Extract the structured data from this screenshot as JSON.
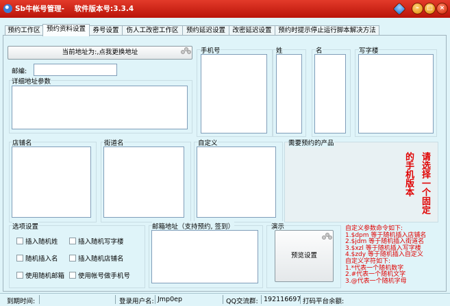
{
  "window": {
    "title": "Sb牛帐号管理-    软件版本号:3.3.4"
  },
  "tabs": [
    {
      "label": "预约工作区"
    },
    {
      "label": "预约资料设置"
    },
    {
      "label": "券号设置"
    },
    {
      "label": "伤人工改密工作区"
    },
    {
      "label": "预约延迟设置"
    },
    {
      "label": "改密延迟设置"
    },
    {
      "label": "预约时提示停止运行脚本解决方法"
    }
  ],
  "form": {
    "address_button": "当前地址为:,点我更换地址",
    "postcode_label": "邮编:",
    "postcode_value": "",
    "detail_address_label": "详细地址参数",
    "phone_label": "手机号",
    "surname_label": "姓",
    "given_name_label": "名",
    "building_label": "写字楼",
    "shop_label": "店铺名",
    "street_label": "街道名",
    "custom_label": "自定义",
    "product_label": "需要预约的产品",
    "product_notice": "请选择一个固定的手机版本",
    "options_label": "选项设置",
    "options": [
      {
        "label": "插入随机姓",
        "checked": false
      },
      {
        "label": "插入随机写字楼",
        "checked": false
      },
      {
        "label": "随机插入名",
        "checked": false
      },
      {
        "label": "插入随机店铺名",
        "checked": false
      },
      {
        "label": "使用随机邮箱",
        "checked": false
      },
      {
        "label": "使用帐号做手机号",
        "checked": false
      }
    ],
    "email_label": "邮箱地址（支持预约, 签到）",
    "demo_label": "演示",
    "preview_button": "预览设置",
    "help_title1": "自定义参数命令如下:",
    "help_lines1": [
      "1.$dpm 等于随机插入店铺名",
      "2.$jdm 等于随机插入街道名",
      "3.$xzl 等于随机插入写字楼",
      "4.$zdy 等于随机插入自定义"
    ],
    "help_title2": "自定义字符如下:",
    "help_lines2": [
      "1.*代表一个随机数字",
      "2.#代表一个随机文字",
      "3.@代表一个随机字母"
    ]
  },
  "status": {
    "expire_label": "到期时间:",
    "expire_value": "",
    "login_label": "登录用户名:",
    "login_value": "Jmp0ep",
    "qq_label": "QQ交流群:",
    "qq_value": "192116697",
    "balance_label": "打码平台余额:",
    "balance_value": ""
  },
  "colors": {
    "title_bar": "#c8200f",
    "background": "#dff4f9",
    "help_text": "#e00000"
  }
}
